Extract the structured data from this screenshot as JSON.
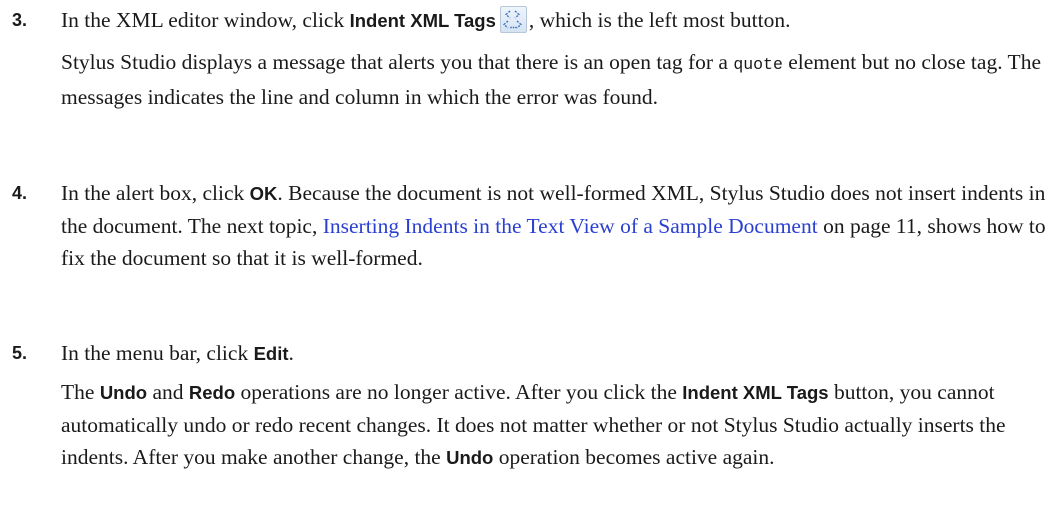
{
  "steps": [
    {
      "number": "3.",
      "line1": {
        "t1": "In the XML editor window, click ",
        "ui1": "Indent XML Tags",
        "icon": "indent-xml-tags-icon",
        "t2": ", which is the left most button."
      },
      "para2": {
        "t1": "Stylus Studio displays a message that alerts you that there is an open tag for a ",
        "code1": "quote",
        "t2": " element but no close tag. The messages indicates the line and column in which the error was found."
      }
    },
    {
      "number": "4.",
      "para1": {
        "t1": "In the alert box, click ",
        "ui1": "OK",
        "t2": ". Because the document is not well-formed XML, Stylus Studio does not insert indents in the document. The next topic, ",
        "link1": "Inserting Indents in the Text View of a Sample Document",
        "t3": " on page 11, shows how to fix the document so that it is well-formed."
      }
    },
    {
      "number": "5.",
      "para1": {
        "t1": "In the menu bar, click ",
        "ui1": "Edit",
        "t2": "."
      },
      "para2": {
        "t1": "The ",
        "ui1": "Undo",
        "t2": " and ",
        "ui2": "Redo",
        "t3": " operations are no longer active. After you click the ",
        "ui3": "Indent XML Tags",
        "t4": " button, you cannot automatically undo or redo recent changes. It does not matter whether or not Stylus Studio actually inserts the indents. After you make another change, the ",
        "ui4": "Undo",
        "t5": " operation becomes active again."
      }
    }
  ]
}
